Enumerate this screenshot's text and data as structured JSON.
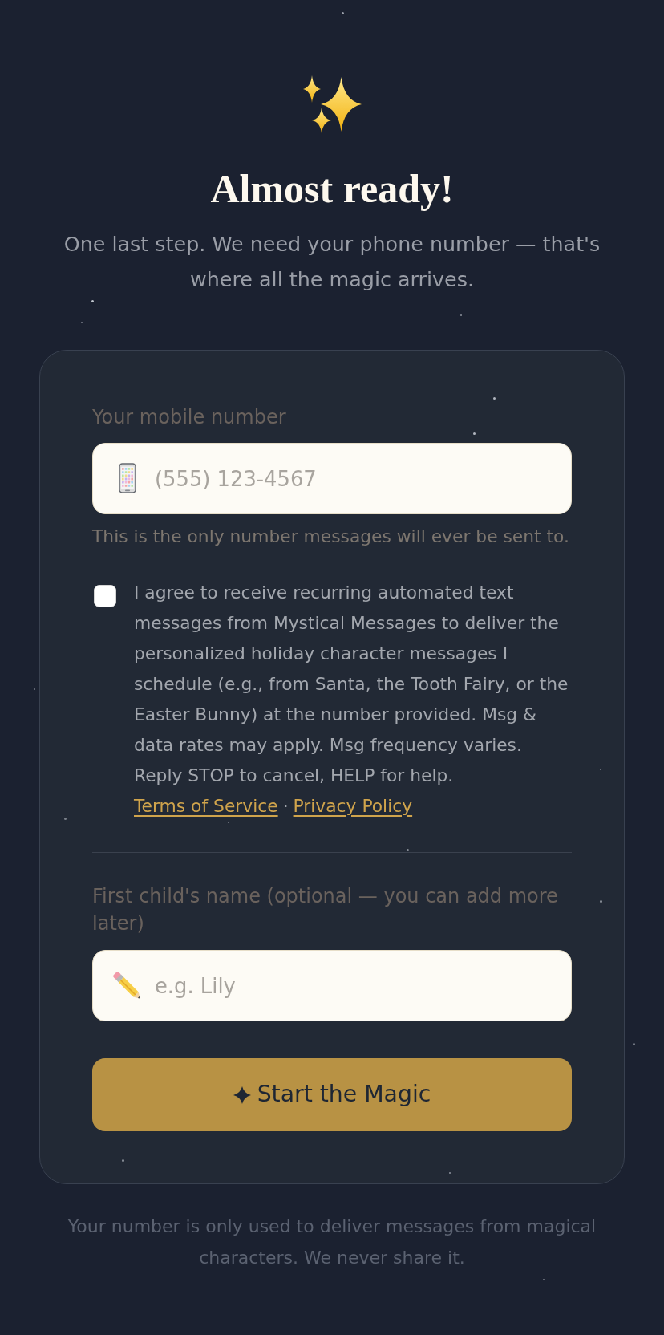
{
  "header": {
    "title": "Almost ready!",
    "subtitle": "One last step. We need your phone number — that's where all the magic arrives."
  },
  "form": {
    "phone": {
      "label": "Your mobile number",
      "placeholder": "(555) 123-4567",
      "hint": "This is the only number messages will ever be sent to."
    },
    "consent": {
      "checked": false,
      "text": "I agree to receive recurring automated text messages from Mystical Messages to deliver the personalized holiday character messages I schedule (e.g., from Santa, the Tooth Fairy, or the Easter Bunny) at the number provided. Msg & data rates may apply. Msg frequency varies. Reply STOP to cancel, HELP for help.",
      "links": [
        {
          "label": "Terms of Service"
        },
        {
          "label": "Privacy Policy"
        }
      ],
      "separator": "·"
    },
    "child_name": {
      "label": "First child's name (optional — you can add more later)",
      "placeholder": "e.g. Lily"
    },
    "submit": {
      "label": "Start the Magic"
    }
  },
  "footer": "Your number is only used to deliver messages from magical characters. We never share it."
}
